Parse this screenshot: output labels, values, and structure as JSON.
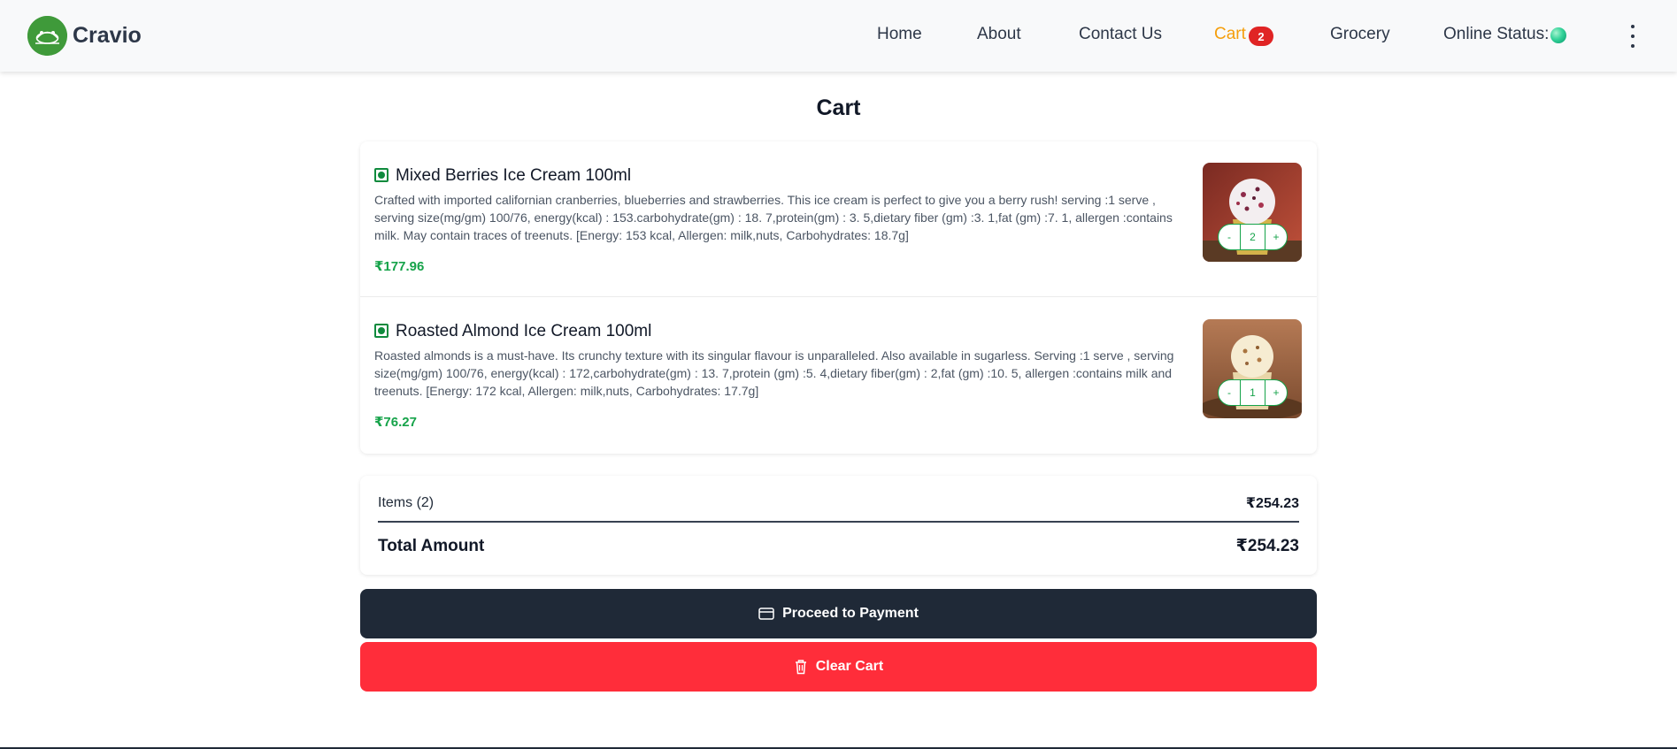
{
  "brand": {
    "name": "Cravio"
  },
  "nav": {
    "home": "Home",
    "about": "About",
    "contact": "Contact Us",
    "cart": "Cart",
    "cart_count": "2",
    "grocery": "Grocery",
    "online_status": "Online Status:"
  },
  "page": {
    "title": "Cart"
  },
  "cart_items": [
    {
      "name": "Mixed Berries Ice Cream 100ml",
      "description": "Crafted with imported californian cranberries, blueberries and strawberries. This ice cream is perfect to give you a berry rush! serving :1 serve , serving size(mg/gm) 100/76, energy(kcal) : 153.carbohydrate(gm) : 18. 7,protein(gm) : 3. 5,dietary fiber (gm) :3. 1,fat (gm) :7. 1, allergen :contains milk. May contain traces of treenuts. [Energy: 153 kcal, Allergen: milk,nuts, Carbohydrates: 18.7g]",
      "price": "₹177.96",
      "quantity": "2",
      "decrement": "-",
      "increment": "+"
    },
    {
      "name": "Roasted Almond Ice Cream 100ml",
      "description": "Roasted almonds is a must-have. Its crunchy texture with its singular flavour is unparalleled. Also available in sugarless. Serving :1 serve , serving size(mg/gm) 100/76, energy(kcal) : 172,carbohydrate(gm) : 13. 7,protein (gm) :5. 4,dietary fiber(gm) : 2,fat (gm) :10. 5, allergen :contains milk and treenuts. [Energy: 172 kcal, Allergen: milk,nuts, Carbohydrates: 17.7g]",
      "price": "₹76.27",
      "quantity": "1",
      "decrement": "-",
      "increment": "+"
    }
  ],
  "summary": {
    "items_label": "Items (2)",
    "items_amount": "₹254.23",
    "total_label": "Total Amount",
    "total_amount": "₹254.23"
  },
  "actions": {
    "pay_label": "Proceed to Payment",
    "clear_label": "Clear Cart"
  },
  "colors": {
    "accent_active": "#f59e0b",
    "price_green": "#16a34a",
    "pay_button": "#1f2937",
    "clear_button": "#ff2d3a",
    "badge": "#e02424"
  }
}
